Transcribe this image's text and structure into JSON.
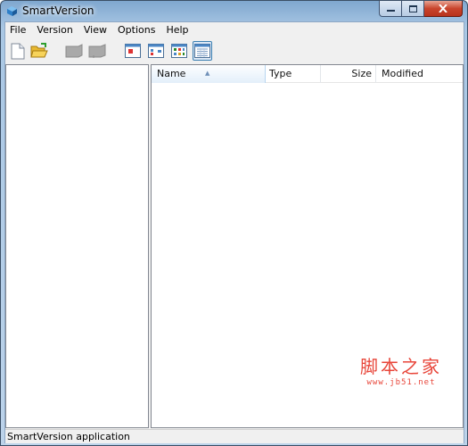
{
  "window": {
    "title": "SmartVersion"
  },
  "menu": [
    "File",
    "Version",
    "View",
    "Options",
    "Help"
  ],
  "toolbar": {
    "buttons": [
      {
        "name": "new-document",
        "icon": "document-icon",
        "enabled": true
      },
      {
        "name": "open-folder",
        "icon": "folder-open-icon",
        "enabled": true
      },
      {
        "name": "tool-disabled-1",
        "icon": "gray-box-icon",
        "enabled": false
      },
      {
        "name": "tool-disabled-2",
        "icon": "gray-box-icon",
        "enabled": false
      },
      {
        "name": "view-large-icons",
        "icon": "large-icons-view-icon",
        "enabled": true
      },
      {
        "name": "view-small-icons",
        "icon": "small-icons-view-icon",
        "enabled": true
      },
      {
        "name": "view-list",
        "icon": "list-view-icon",
        "enabled": true
      },
      {
        "name": "view-details",
        "icon": "details-view-icon",
        "enabled": true,
        "pressed": true
      }
    ]
  },
  "file_list": {
    "columns": [
      "Name",
      "Type",
      "Size",
      "Modified"
    ],
    "sorted_by": "Name",
    "rows": []
  },
  "status": {
    "text": "SmartVersion application"
  },
  "watermark": {
    "chinese": "脚本之家",
    "url": "www.jb51.net"
  },
  "colors": {
    "accent": "#3c7fb1",
    "watermark": "#e8463a",
    "close_button": "#c9452d"
  }
}
